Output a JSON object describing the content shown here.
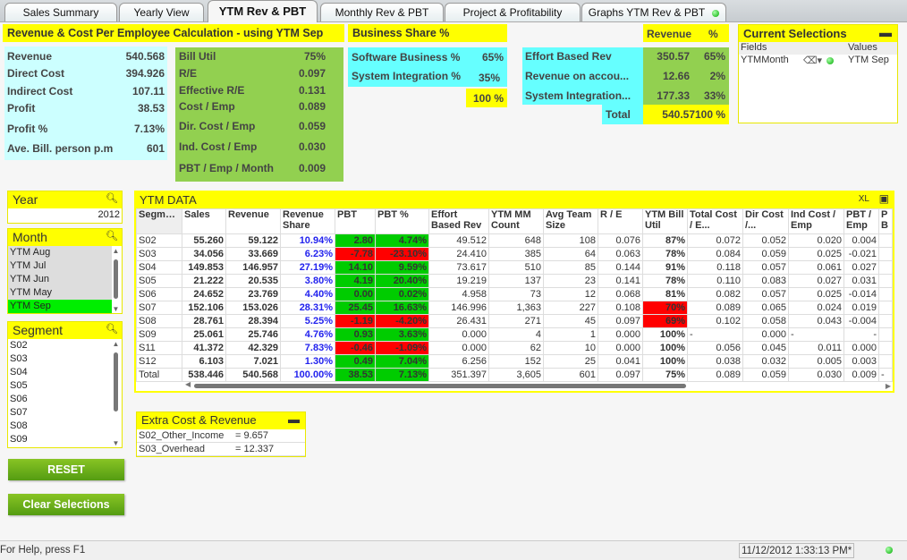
{
  "tabs": [
    {
      "label": "Sales Summary"
    },
    {
      "label": "Yearly View"
    },
    {
      "label": "YTM Rev & PBT",
      "active": true
    },
    {
      "label": "Monthly Rev & PBT"
    },
    {
      "label": "Project & Profitability"
    },
    {
      "label": "Graphs YTM Rev & PBT"
    }
  ],
  "calc": {
    "title": "Revenue & Cost Per Employee Calculation - using YTM Sep",
    "left": [
      {
        "label": "Revenue",
        "value": "540.568"
      },
      {
        "label": "Direct Cost",
        "value": "394.926"
      },
      {
        "label": "Indirect Cost",
        "value": "107.11"
      },
      {
        "label": "Profit",
        "value": "38.53"
      },
      {
        "label": "Profit %",
        "value": "7.13%"
      },
      {
        "label": "Ave. Bill. person p.m",
        "value": "601"
      }
    ],
    "right": [
      {
        "label": "Bill Util",
        "value": "75%"
      },
      {
        "label": "R/E",
        "value": "0.097"
      },
      {
        "label": "Effective R/E",
        "value": "0.131"
      },
      {
        "label": "Cost / Emp",
        "value": "0.089"
      },
      {
        "label": "Dir. Cost / Emp",
        "value": "0.059"
      },
      {
        "label": "Ind. Cost / Emp",
        "value": "0.030"
      },
      {
        "label": "PBT / Emp / Month",
        "value": "0.009"
      }
    ]
  },
  "business_share": {
    "title": "Business Share %",
    "rows": [
      {
        "label": "Software Business %",
        "value": "65%"
      },
      {
        "label": "System Integration %",
        "value": "35%"
      }
    ],
    "total": "100 %"
  },
  "revenue_split": {
    "col_revenue": "Revenue",
    "col_pct": "%",
    "rows": [
      {
        "label": "Effort Based Rev",
        "revenue": "350.57",
        "pct": "65%"
      },
      {
        "label": "Revenue  on accou...",
        "revenue": "12.66",
        "pct": "2%"
      },
      {
        "label": "System  Integration...",
        "revenue": "177.33",
        "pct": "33%"
      }
    ],
    "total_label": "Total",
    "total_revenue": "540.57",
    "total_pct": "100 %"
  },
  "current_selections": {
    "title": "Current Selections",
    "col_fields": "Fields",
    "col_values": "Values",
    "rows": [
      {
        "field": "YTMMonth",
        "value": "YTM Sep"
      }
    ]
  },
  "year": {
    "title": "Year",
    "value": "2012"
  },
  "month": {
    "title": "Month",
    "items": [
      {
        "label": "YTM Aug"
      },
      {
        "label": "YTM Jul"
      },
      {
        "label": "YTM Jun"
      },
      {
        "label": "YTM May"
      },
      {
        "label": "YTM Sep",
        "selected": true
      }
    ]
  },
  "segment": {
    "title": "Segment",
    "items": [
      "S02",
      "S03",
      "S04",
      "S05",
      "S06",
      "S07",
      "S08",
      "S09"
    ]
  },
  "ytm": {
    "title": "YTM DATA",
    "xl": "XL",
    "columns": [
      "Segment",
      "Sales",
      "Revenue",
      "Revenue Share",
      "PBT",
      "PBT %",
      "Effort Based Rev",
      "YTM MM Count",
      "Avg Team Size",
      "R / E",
      "YTM Bill Util",
      "Total Cost / E...",
      "Dir Cost /...",
      "Ind Cost / Emp",
      "PBT / Emp",
      "P B"
    ],
    "rows": [
      [
        "S02",
        "55.260",
        "59.122",
        "10.94%",
        "2.80",
        "4.74%",
        "49.512",
        "648",
        "108",
        "0.076",
        "87%",
        "0.072",
        "0.052",
        "0.020",
        "0.004",
        ""
      ],
      [
        "S03",
        "34.056",
        "33.669",
        "6.23%",
        "-7.78",
        "-23.10%",
        "24.410",
        "385",
        "64",
        "0.063",
        "78%",
        "0.084",
        "0.059",
        "0.025",
        "-0.021",
        ""
      ],
      [
        "S04",
        "149.853",
        "146.957",
        "27.19%",
        "14.10",
        "9.59%",
        "73.617",
        "510",
        "85",
        "0.144",
        "91%",
        "0.118",
        "0.057",
        "0.061",
        "0.027",
        ""
      ],
      [
        "S05",
        "21.222",
        "20.535",
        "3.80%",
        "4.19",
        "20.40%",
        "19.219",
        "137",
        "23",
        "0.141",
        "78%",
        "0.110",
        "0.083",
        "0.027",
        "0.031",
        ""
      ],
      [
        "S06",
        "24.652",
        "23.769",
        "4.40%",
        "0.00",
        "0.02%",
        "4.958",
        "73",
        "12",
        "0.068",
        "81%",
        "0.082",
        "0.057",
        "0.025",
        "-0.014",
        ""
      ],
      [
        "S07",
        "152.106",
        "153.026",
        "28.31%",
        "25.45",
        "16.63%",
        "146.996",
        "1,363",
        "227",
        "0.108",
        "70%",
        "0.089",
        "0.065",
        "0.024",
        "0.019",
        ""
      ],
      [
        "S08",
        "28.761",
        "28.394",
        "5.25%",
        "-1.19",
        "-4.20%",
        "26.431",
        "271",
        "45",
        "0.097",
        "69%",
        "0.102",
        "0.058",
        "0.043",
        "-0.004",
        ""
      ],
      [
        "S09",
        "25.061",
        "25.746",
        "4.76%",
        "0.93",
        "3.63%",
        "0.000",
        "4",
        "1",
        "0.000",
        "100%",
        "-",
        "0.000",
        "-",
        "-",
        ""
      ],
      [
        "S11",
        "41.372",
        "42.329",
        "7.83%",
        "-0.46",
        "-1.09%",
        "0.000",
        "62",
        "10",
        "0.000",
        "100%",
        "0.056",
        "0.045",
        "0.011",
        "0.000",
        ""
      ],
      [
        "S12",
        "6.103",
        "7.021",
        "1.30%",
        "0.49",
        "7.04%",
        "6.256",
        "152",
        "25",
        "0.041",
        "100%",
        "0.038",
        "0.032",
        "0.005",
        "0.003",
        ""
      ],
      [
        "Total",
        "538.446",
        "540.568",
        "100.00%",
        "38.53",
        "7.13%",
        "351.397",
        "3,605",
        "601",
        "0.097",
        "75%",
        "0.089",
        "0.059",
        "0.030",
        "0.009",
        "-"
      ]
    ]
  },
  "extra": {
    "title": "Extra Cost & Revenue",
    "rows": [
      {
        "label": "S02_Other_Income",
        "value": "= 9.657"
      },
      {
        "label": "S03_Overhead",
        "value": "= 12.337"
      }
    ]
  },
  "buttons": {
    "reset": "RESET",
    "clear": "Clear Selections"
  },
  "status": {
    "help": "For Help, press F1",
    "datetime": "11/12/2012 1:33:13 PM*"
  },
  "colors": {
    "yellow": "#ffff00",
    "cyan": "#ccffff",
    "green": "#92d050",
    "positive": "#00cc00",
    "negative": "#ff0000",
    "selected": "#00ee00"
  }
}
